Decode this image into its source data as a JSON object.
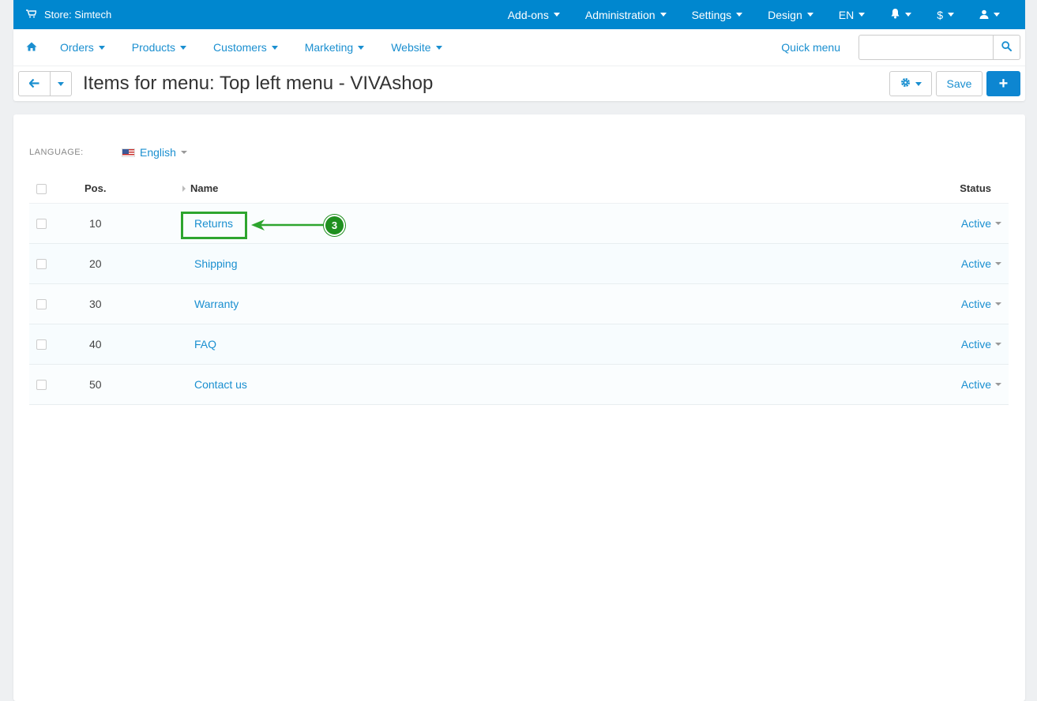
{
  "topbar": {
    "store_label": "Store: Simtech",
    "menus": [
      "Add-ons",
      "Administration",
      "Settings",
      "Design",
      "EN"
    ],
    "currency": "$"
  },
  "navbar": {
    "items": [
      "Orders",
      "Products",
      "Customers",
      "Marketing",
      "Website"
    ],
    "quick_menu": "Quick menu",
    "search_placeholder": ""
  },
  "titlebar": {
    "title": "Items for menu: Top left menu - VIVAshop",
    "save_label": "Save",
    "add_label": "+"
  },
  "language": {
    "label": "LANGUAGE:",
    "value": "English"
  },
  "table": {
    "headers": {
      "pos": "Pos.",
      "name": "Name",
      "status": "Status"
    },
    "rows": [
      {
        "pos": "10",
        "name": "Returns",
        "status": "Active"
      },
      {
        "pos": "20",
        "name": "Shipping",
        "status": "Active"
      },
      {
        "pos": "30",
        "name": "Warranty",
        "status": "Active"
      },
      {
        "pos": "40",
        "name": "FAQ",
        "status": "Active"
      },
      {
        "pos": "50",
        "name": "Contact us",
        "status": "Active"
      }
    ]
  },
  "annotation": {
    "badge": "3",
    "color": "#2ea52e"
  },
  "colors": {
    "brand": "#0087cf",
    "link": "#1a8fd0"
  }
}
